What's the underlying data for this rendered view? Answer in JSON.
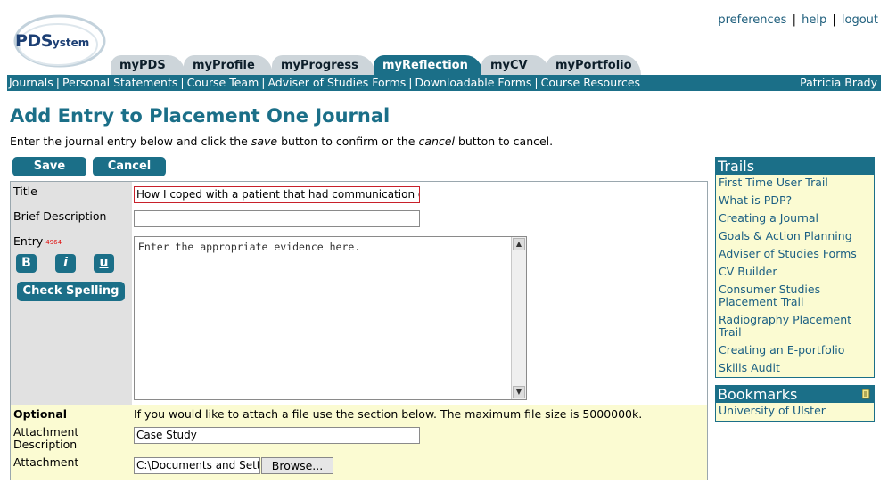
{
  "logo": {
    "big": "PDS",
    "small": "ystem"
  },
  "top_links": [
    {
      "label": "preferences"
    },
    {
      "label": "help"
    },
    {
      "label": "logout"
    }
  ],
  "tabs": [
    {
      "label": "myPDS",
      "active": false
    },
    {
      "label": "myProfile",
      "active": false
    },
    {
      "label": "myProgress",
      "active": false
    },
    {
      "label": "myReflection",
      "active": true
    },
    {
      "label": "myCV",
      "active": false
    },
    {
      "label": "myPortfolio",
      "active": false
    }
  ],
  "subnav": {
    "links": [
      "Journals",
      "Personal Statements",
      "Course Team",
      "Adviser of Studies Forms",
      "Downloadable Forms",
      "Course Resources"
    ],
    "user": "Patricia Brady"
  },
  "page": {
    "title": "Add Entry to Placement One Journal",
    "intro_before": "Enter the journal entry below and click the ",
    "intro_save": "save",
    "intro_middle": " button to confirm or the ",
    "intro_cancel": "cancel",
    "intro_after": " button to cancel."
  },
  "actions": {
    "save": "Save",
    "cancel": "Cancel"
  },
  "form": {
    "title_label": "Title",
    "title_value": "How I coped with a patient that had communication diff",
    "brief_label": "Brief Description",
    "brief_value": "",
    "entry_label": "Entry",
    "entry_counter": "4964",
    "bold": "B",
    "italic": "i",
    "underline": "u",
    "spell": "Check Spelling",
    "entry_placeholder": "Enter the appropriate evidence here.",
    "optional_label": "Optional",
    "optional_note": "If you would like to attach a file use the section below. The maximum file size is 5000000k.",
    "attach_desc_label": "Attachment Description",
    "attach_desc_value": "Case Study",
    "attachment_label": "Attachment",
    "attachment_value": "C:\\Documents and Setti",
    "browse": "Browse..."
  },
  "trails": {
    "title": "Trails",
    "items": [
      "First Time User Trail",
      "What is PDP?",
      "Creating a Journal",
      "Goals & Action Planning",
      "Adviser of Studies Forms",
      "CV Builder",
      "Consumer Studies Placement Trail",
      "Radiography Placement Trail",
      "Creating an E-portfolio",
      "Skills Audit"
    ]
  },
  "bookmarks": {
    "title": "Bookmarks",
    "items": [
      "University of Ulster"
    ]
  },
  "colors": {
    "brand": "#1b6f88",
    "tab_inactive": "#cdd5da",
    "panel_bg": "#fbfbd2",
    "label_bg": "#e1e1e1"
  }
}
